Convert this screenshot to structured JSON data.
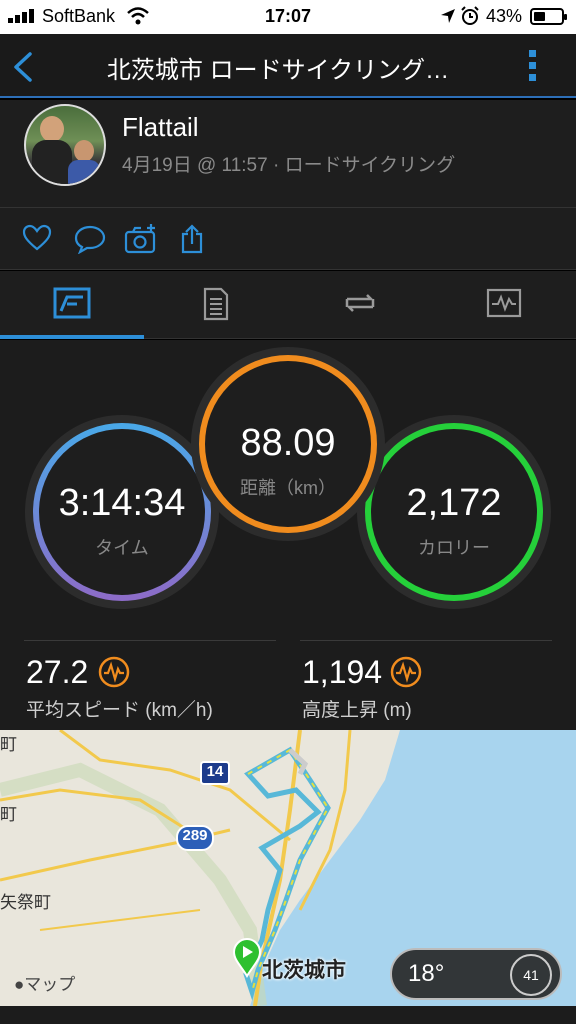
{
  "status_bar": {
    "carrier": "SoftBank",
    "time": "17:07",
    "battery_pct": "43%",
    "battery_level": 0.43
  },
  "nav": {
    "title": "北茨城市 ロードサイクリング…",
    "back_icon": "chevron-left-icon",
    "more_icon": "vertical-ellipsis-icon"
  },
  "profile": {
    "name": "Flattail",
    "subtitle": "4月19日 @ 11:57 · ロードサイクリング"
  },
  "actions": [
    "heart-icon",
    "comment-icon",
    "add-photo-icon",
    "share-icon"
  ],
  "tabs": [
    {
      "icon": "stats-overview-icon",
      "active": true
    },
    {
      "icon": "details-list-icon",
      "active": false
    },
    {
      "icon": "laps-icon",
      "active": false
    },
    {
      "icon": "chart-icon",
      "active": false
    }
  ],
  "rings": {
    "time": {
      "value": "3:14:34",
      "label": "タイム",
      "color_start": "#4aa8e8",
      "color_end": "#8c6cc8"
    },
    "distance": {
      "value": "88.09",
      "label": "距離（km）",
      "color": "#f08c1e"
    },
    "calories": {
      "value": "2,172",
      "label": "カロリー",
      "color": "#25d03a"
    }
  },
  "metrics": {
    "avg_speed": {
      "value": "27.2",
      "label": "平均スピード (km／h)"
    },
    "elevation_gain": {
      "value": "1,194",
      "label": "高度上昇 (m)"
    }
  },
  "map": {
    "city_label": "北茨城市",
    "place_labels": [
      "町",
      "町",
      "矢祭町"
    ],
    "route_shields": [
      "14",
      "289"
    ],
    "weather_temp": "18°",
    "wind_value": "41",
    "attribution": "マップ",
    "sea_color": "#a8d4ee",
    "land_color": "#e9e6dc",
    "road_color": "#f2c94c"
  }
}
